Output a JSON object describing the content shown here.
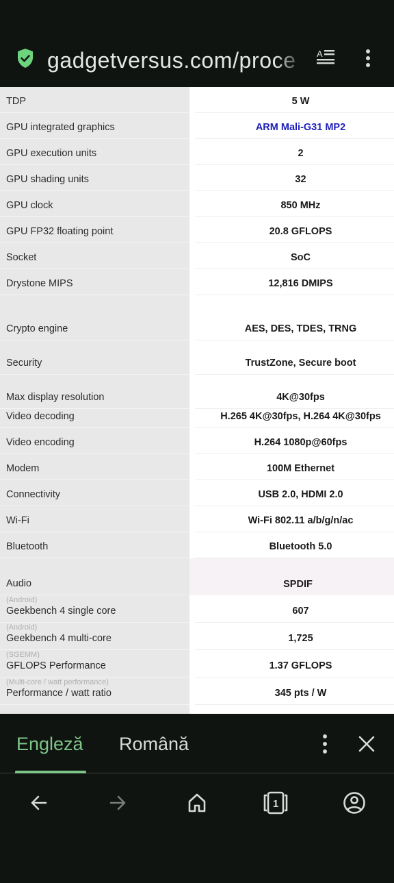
{
  "browser": {
    "url": "gadgetversus.com/processor/",
    "url_displayed": "gadgetversus.com/proce",
    "secure_icon": "shield-check-icon",
    "reader_mode_icon": "reader-mode-icon",
    "menu_icon": "more-vert-icon"
  },
  "colors": {
    "accent_green": "#7cc488",
    "link_blue": "#2020b8",
    "chrome_bg": "#101411",
    "label_col_bg": "#e8e8e8"
  },
  "specs": [
    {
      "label": "TDP",
      "value": "5 W"
    },
    {
      "label": "GPU integrated graphics",
      "value": "ARM Mali-G31 MP2",
      "link": true
    },
    {
      "label": "GPU execution units",
      "value": "2"
    },
    {
      "label": "GPU shading units",
      "value": "32"
    },
    {
      "label": "GPU clock",
      "value": "850 MHz"
    },
    {
      "label": "GPU FP32 floating point",
      "value": "20.8 GFLOPS"
    },
    {
      "label": "Socket",
      "value": "SoC"
    },
    {
      "label": "Drystone MIPS",
      "value": "12,816 DMIPS"
    },
    {
      "label": "Crypto engine",
      "value": "AES, DES, TDES, TRNG"
    },
    {
      "label": "Security",
      "value": "TrustZone, Secure boot"
    },
    {
      "label": "Max display resolution",
      "value": "4K@30fps"
    },
    {
      "label": "Video decoding",
      "value": "H.265 4K@30fps, H.264 4K@30fps"
    },
    {
      "label": "Video encoding",
      "value": "H.264 1080p@60fps"
    },
    {
      "label": "Modem",
      "value": "100M Ethernet"
    },
    {
      "label": "Connectivity",
      "value": "USB 2.0, HDMI 2.0"
    },
    {
      "label": "Wi-Fi",
      "value": "Wi-Fi 802.11 a/b/g/n/ac"
    },
    {
      "label": "Bluetooth",
      "value": "Bluetooth 5.0"
    },
    {
      "label": "Audio",
      "value": "SPDIF"
    },
    {
      "label": "Geekbench 4 single core",
      "sublabel": "(Android)",
      "value": "607"
    },
    {
      "label": "Geekbench 4 multi-core",
      "sublabel": "(Android)",
      "value": "1,725"
    },
    {
      "label": "GFLOPS Performance",
      "sublabel": "(SGEMM)",
      "value": "1.37 GFLOPS"
    },
    {
      "label": "Performance / watt ratio",
      "sublabel": "(Multi-core / watt performance)",
      "value": "345 pts / W"
    }
  ],
  "translate_bar": {
    "tabs": [
      {
        "label": "Engleză",
        "selected": true
      },
      {
        "label": "Română",
        "selected": false
      }
    ],
    "menu_icon": "more-vert-icon",
    "close_icon": "close-icon"
  },
  "nav": {
    "back_icon": "arrow-back-icon",
    "forward_icon": "arrow-forward-icon",
    "home_icon": "home-icon",
    "tabs_icon": "tabs-icon",
    "tab_count": "1",
    "account_icon": "account-icon"
  }
}
